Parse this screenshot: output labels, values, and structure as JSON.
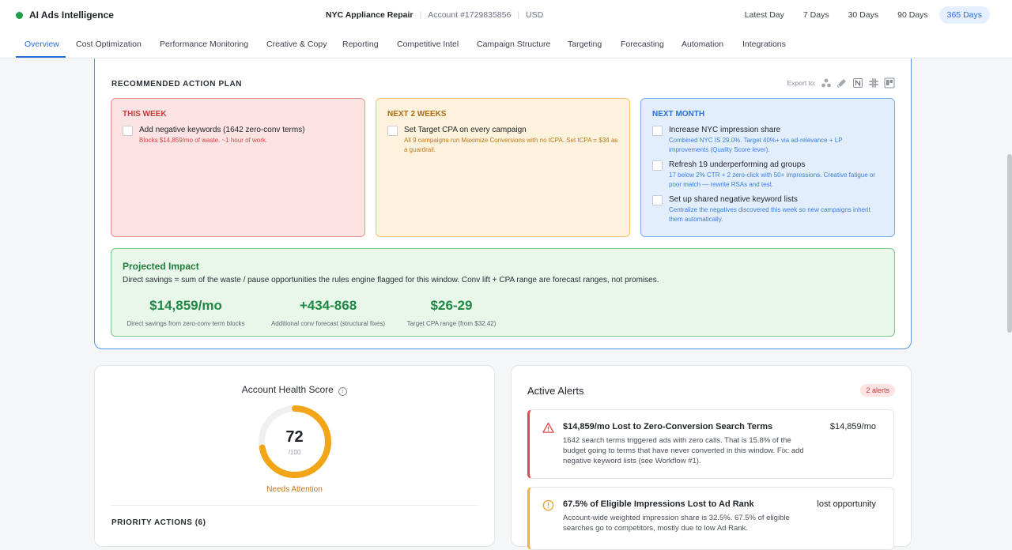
{
  "app": {
    "title": "AI Ads Intelligence"
  },
  "account": {
    "name": "NYC Appliance Repair",
    "id": "Account #1729835856",
    "currency": "USD"
  },
  "ranges": [
    {
      "label": "Latest Day",
      "active": false
    },
    {
      "label": "7 Days",
      "active": false
    },
    {
      "label": "30 Days",
      "active": false
    },
    {
      "label": "90 Days",
      "active": false
    },
    {
      "label": "365 Days",
      "active": true
    }
  ],
  "tabs": [
    "Overview",
    "Cost Optimization",
    "Performance Monitoring",
    "Creative & Copy",
    "Reporting",
    "Competitive Intel",
    "Campaign Structure",
    "Targeting",
    "Forecasting",
    "Automation",
    "Integrations"
  ],
  "plan": {
    "heading": "RECOMMENDED ACTION PLAN",
    "export_label": "Export to:",
    "export_icons": [
      "asana-icon",
      "linear-icon",
      "notion-icon",
      "slack-icon",
      "trello-icon"
    ],
    "this_week": {
      "heading": "THIS WEEK",
      "items": [
        {
          "title": "Add negative keywords (1642 zero-conv terms)",
          "sub": "Blocks $14,859/mo of waste. ~1 hour of work."
        }
      ]
    },
    "next_2_weeks": {
      "heading": "NEXT 2 WEEKS",
      "items": [
        {
          "title": "Set Target CPA on every campaign",
          "sub": "All 9 campaigns run Maximize Conversions with no tCPA. Set tCPA = $34 as a guardrail."
        }
      ]
    },
    "next_month": {
      "heading": "NEXT MONTH",
      "items": [
        {
          "title": "Increase NYC impression share",
          "sub": "Combined NYC IS 29.0%. Target 40%+ via ad-relevance + LP improvements (Quality Score lever)."
        },
        {
          "title": "Refresh 19 underperforming ad groups",
          "sub": "17 below 2% CTR + 2 zero-click with 50+ impressions. Creative fatigue or poor match — rewrite RSAs and test."
        },
        {
          "title": "Set up shared negative keyword lists",
          "sub": "Centralize the negatives discovered this week so new campaigns inherit them automatically."
        }
      ]
    }
  },
  "impact": {
    "heading": "Projected Impact",
    "description": "Direct savings = sum of the waste / pause opportunities the rules engine flagged for this window. Conv lift + CPA range are forecast ranges, not promises.",
    "metrics": [
      {
        "value": "$14,859/mo",
        "label": "Direct savings from zero-conv term blocks"
      },
      {
        "value": "+434-868",
        "label": "Additional conv forecast (structural fixes)"
      },
      {
        "value": "$26-29",
        "label": "Target CPA range (from $32.42)"
      }
    ]
  },
  "health": {
    "title": "Account Health Score",
    "score": "72",
    "score_value": 72,
    "out_of": "/100",
    "status": "Needs Attention",
    "priority_heading": "PRIORITY ACTIONS (6)",
    "gauge_color": "#f2a516"
  },
  "alerts": {
    "title": "Active Alerts",
    "badge": "2 alerts",
    "items": [
      {
        "title": "$14,859/mo Lost to Zero-Conversion Search Terms",
        "amount": "$14,859/mo",
        "body": "1642 search terms triggered ads with zero calls. That is 15.8% of the budget going to terms that have never converted in this window. Fix: add negative keyword lists (see Workflow #1).",
        "icon": "warning-triangle-icon"
      },
      {
        "title": "67.5% of Eligible Impressions Lost to Ad Rank",
        "amount": "lost opportunity",
        "body": "Account-wide weighted impression share is 32.5%. 67.5% of eligible searches go to competitors, mostly due to low Ad Rank.",
        "icon": "alert-circle-icon"
      }
    ]
  }
}
